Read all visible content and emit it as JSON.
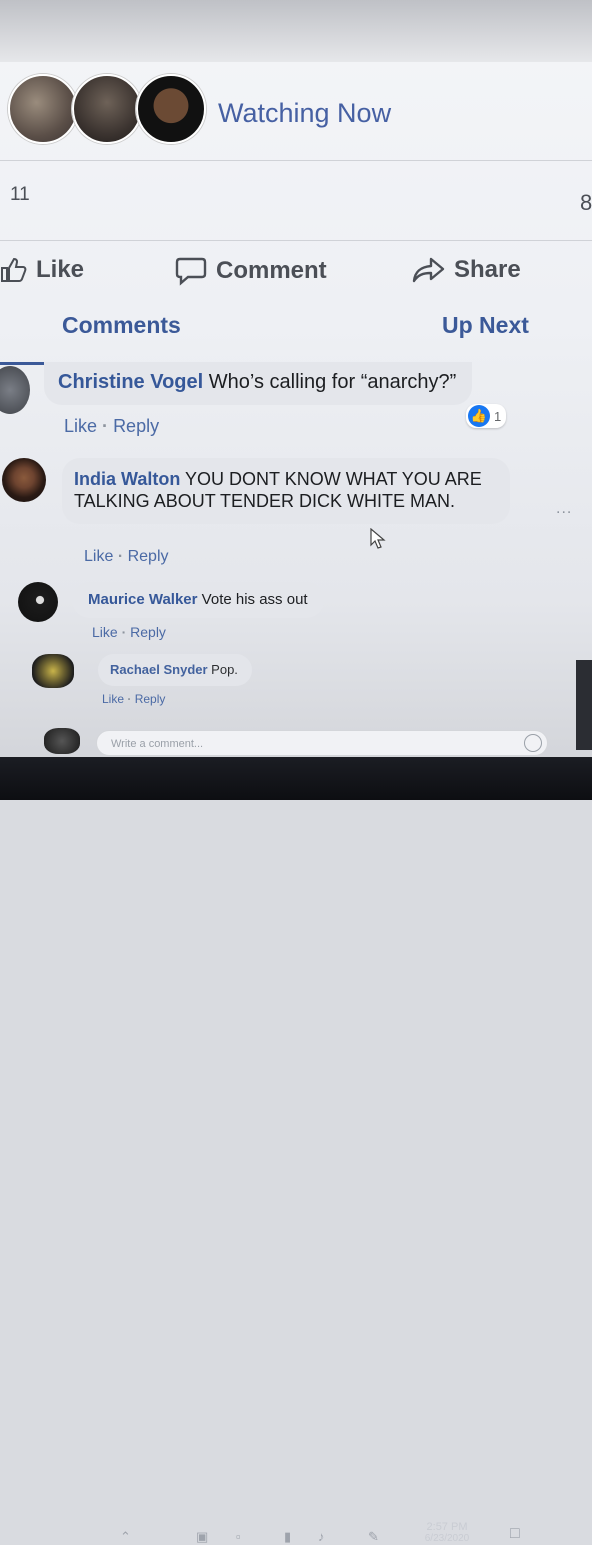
{
  "viewers": {
    "label": "Watching Now"
  },
  "counts": {
    "left": "11",
    "right": "8"
  },
  "actions": {
    "like": "Like",
    "comment": "Comment",
    "share": "Share"
  },
  "tabs": {
    "comments": "Comments",
    "upnext": "Up Next"
  },
  "comments": [
    {
      "author": "Christine Vogel",
      "text": "Who’s calling for “anarchy?”",
      "like": "Like",
      "reply": "Reply",
      "sep": "·",
      "reactions": "1"
    },
    {
      "author": "India Walton",
      "text": "YOU DONT KNOW WHAT YOU ARE TALKING ABOUT TENDER DICK WHITE MAN.",
      "like": "Like",
      "reply": "Reply",
      "sep": "·"
    },
    {
      "author": "Maurice Walker",
      "text": "Vote his ass out",
      "like": "Like",
      "reply": "Reply",
      "sep": "·"
    },
    {
      "author": "Rachael Snyder",
      "text": "Pop.",
      "like": "Like",
      "reply": "Reply",
      "sep": "·"
    }
  ],
  "composer": {
    "placeholder": "Write a comment..."
  },
  "more": "...",
  "taskbar": {
    "time": "2:57 PM",
    "date": "6/23/2020"
  },
  "colors": {
    "link": "#365899",
    "accent": "#3b5998",
    "bubble": "#e4e6eb"
  }
}
